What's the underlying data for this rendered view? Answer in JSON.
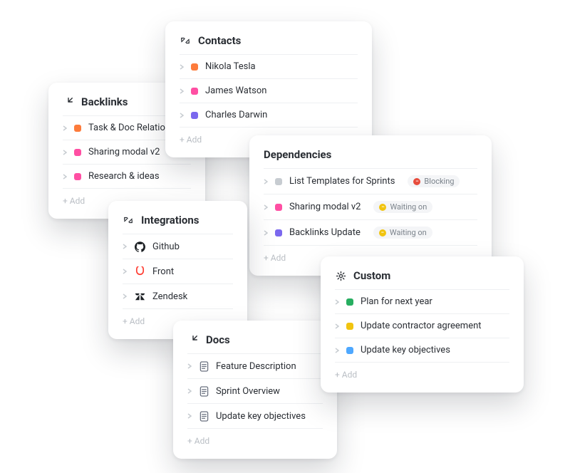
{
  "add_label": "+ Add",
  "colors": {
    "orange": "#fd7b3b",
    "pink": "#ff4fa3",
    "purple": "#7b68ee",
    "grey": "#c7ccd1",
    "green": "#27ae60",
    "yellow": "#f1c40f",
    "blue": "#4ea8ff",
    "red": "#e74c3c"
  },
  "cards": {
    "backlinks": {
      "title": "Backlinks",
      "icon": "arrow-in-icon",
      "items": [
        {
          "label": "Task & Doc Relationships",
          "color": "orange"
        },
        {
          "label": "Sharing modal v2",
          "color": "pink"
        },
        {
          "label": "Research & ideas",
          "color": "pink"
        }
      ]
    },
    "contacts": {
      "title": "Contacts",
      "icon": "link-arrows-icon",
      "items": [
        {
          "label": "Nikola Tesla",
          "color": "orange"
        },
        {
          "label": "James Watson",
          "color": "pink"
        },
        {
          "label": "Charles Darwin",
          "color": "purple"
        }
      ]
    },
    "integrations": {
      "title": "Integrations",
      "icon": "link-arrows-icon",
      "items": [
        {
          "label": "Github",
          "icon": "github-icon"
        },
        {
          "label": "Front",
          "icon": "front-icon"
        },
        {
          "label": "Zendesk",
          "icon": "zendesk-icon"
        }
      ]
    },
    "dependencies": {
      "title": "Dependencies",
      "items": [
        {
          "label": "List Templates for Sprints",
          "color": "grey",
          "badge": {
            "text": "Blocking",
            "kind": "blocking"
          }
        },
        {
          "label": "Sharing modal v2",
          "color": "pink",
          "badge": {
            "text": "Waiting on",
            "kind": "waiting"
          }
        },
        {
          "label": "Backlinks Update",
          "color": "purple",
          "badge": {
            "text": "Waiting on",
            "kind": "waiting"
          }
        }
      ]
    },
    "docs": {
      "title": "Docs",
      "icon": "arrow-in-icon",
      "items": [
        {
          "label": "Feature Description"
        },
        {
          "label": "Sprint Overview"
        },
        {
          "label": "Update key objectives"
        }
      ]
    },
    "custom": {
      "title": "Custom",
      "icon": "gear-icon",
      "items": [
        {
          "label": "Plan for next year",
          "color": "green"
        },
        {
          "label": "Update contractor agreement",
          "color": "yellow"
        },
        {
          "label": "Update key objectives",
          "color": "blue"
        }
      ]
    }
  }
}
